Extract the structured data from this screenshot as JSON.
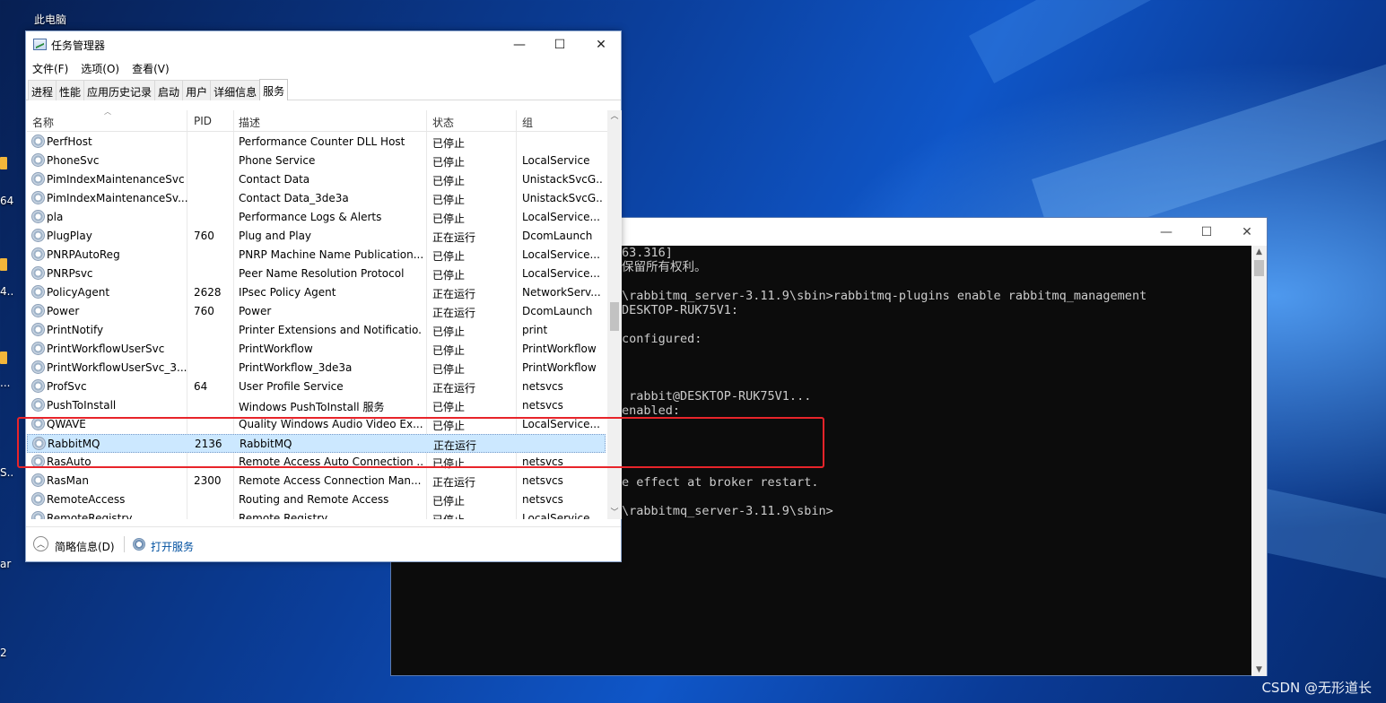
{
  "desktop": {
    "icon_label": "此电脑",
    "fragments": [
      "64",
      "4..",
      "...",
      "S..",
      "ar",
      "2"
    ],
    "watermark": "CSDN @无形道长"
  },
  "console": {
    "lines": [
      "63.316]",
      "保留所有权利。",
      "",
      "\\rabbitmq_server-3.11.9\\sbin>rabbitmq-plugins enable rabbitmq_management",
      "DESKTOP-RUK75V1:",
      "",
      "configured:",
      "",
      "",
      "",
      " rabbit@DESKTOP-RUK75V1...",
      "enabled:",
      "",
      "",
      "",
      "",
      "e effect at broker restart.",
      "",
      "\\rabbitmq_server-3.11.9\\sbin>"
    ],
    "controls": {
      "minimize": "—",
      "maximize": "☐",
      "close": "✕"
    }
  },
  "taskmgr": {
    "title": "任务管理器",
    "controls": {
      "minimize": "—",
      "maximize": "☐",
      "close": "✕"
    },
    "menu": [
      "文件(F)",
      "选项(O)",
      "查看(V)"
    ],
    "tabs": [
      "进程",
      "性能",
      "应用历史记录",
      "启动",
      "用户",
      "详细信息",
      "服务"
    ],
    "active_tab": "服务",
    "columns": {
      "name": "名称",
      "pid": "PID",
      "desc": "描述",
      "status": "状态",
      "group": "组"
    },
    "rows": [
      {
        "name": "PerfHost",
        "pid": "",
        "desc": "Performance Counter DLL Host",
        "status": "已停止",
        "group": ""
      },
      {
        "name": "PhoneSvc",
        "pid": "",
        "desc": "Phone Service",
        "status": "已停止",
        "group": "LocalService"
      },
      {
        "name": "PimIndexMaintenanceSvc",
        "pid": "",
        "desc": "Contact Data",
        "status": "已停止",
        "group": "UnistackSvcG..."
      },
      {
        "name": "PimIndexMaintenanceSv...",
        "pid": "",
        "desc": "Contact Data_3de3a",
        "status": "已停止",
        "group": "UnistackSvcG..."
      },
      {
        "name": "pla",
        "pid": "",
        "desc": "Performance Logs & Alerts",
        "status": "已停止",
        "group": "LocalService..."
      },
      {
        "name": "PlugPlay",
        "pid": "760",
        "desc": "Plug and Play",
        "status": "正在运行",
        "group": "DcomLaunch"
      },
      {
        "name": "PNRPAutoReg",
        "pid": "",
        "desc": "PNRP Machine Name Publication...",
        "status": "已停止",
        "group": "LocalService..."
      },
      {
        "name": "PNRPsvc",
        "pid": "",
        "desc": "Peer Name Resolution Protocol",
        "status": "已停止",
        "group": "LocalService..."
      },
      {
        "name": "PolicyAgent",
        "pid": "2628",
        "desc": "IPsec Policy Agent",
        "status": "正在运行",
        "group": "NetworkServ..."
      },
      {
        "name": "Power",
        "pid": "760",
        "desc": "Power",
        "status": "正在运行",
        "group": "DcomLaunch"
      },
      {
        "name": "PrintNotify",
        "pid": "",
        "desc": "Printer Extensions and Notificatio...",
        "status": "已停止",
        "group": "print"
      },
      {
        "name": "PrintWorkflowUserSvc",
        "pid": "",
        "desc": "PrintWorkflow",
        "status": "已停止",
        "group": "PrintWorkflow"
      },
      {
        "name": "PrintWorkflowUserSvc_3...",
        "pid": "",
        "desc": "PrintWorkflow_3de3a",
        "status": "已停止",
        "group": "PrintWorkflow"
      },
      {
        "name": "ProfSvc",
        "pid": "64",
        "desc": "User Profile Service",
        "status": "正在运行",
        "group": "netsvcs"
      },
      {
        "name": "PushToInstall",
        "pid": "",
        "desc": "Windows PushToInstall 服务",
        "status": "已停止",
        "group": "netsvcs"
      },
      {
        "name": "QWAVE",
        "pid": "",
        "desc": "Quality Windows Audio Video Ex...",
        "status": "已停止",
        "group": "LocalService..."
      },
      {
        "name": "RabbitMQ",
        "pid": "2136",
        "desc": "RabbitMQ",
        "status": "正在运行",
        "group": ""
      },
      {
        "name": "RasAuto",
        "pid": "",
        "desc": "Remote Access Auto Connection ...",
        "status": "已停止",
        "group": "netsvcs"
      },
      {
        "name": "RasMan",
        "pid": "2300",
        "desc": "Remote Access Connection Man...",
        "status": "正在运行",
        "group": "netsvcs"
      },
      {
        "name": "RemoteAccess",
        "pid": "",
        "desc": "Routing and Remote Access",
        "status": "已停止",
        "group": "netsvcs"
      },
      {
        "name": "RemoteRegistry",
        "pid": "",
        "desc": "Remote Registry",
        "status": "已停止",
        "group": "LocalService"
      }
    ],
    "selected_row": "RabbitMQ",
    "footer": {
      "summary": "简略信息(D)",
      "open_services": "打开服务"
    }
  }
}
